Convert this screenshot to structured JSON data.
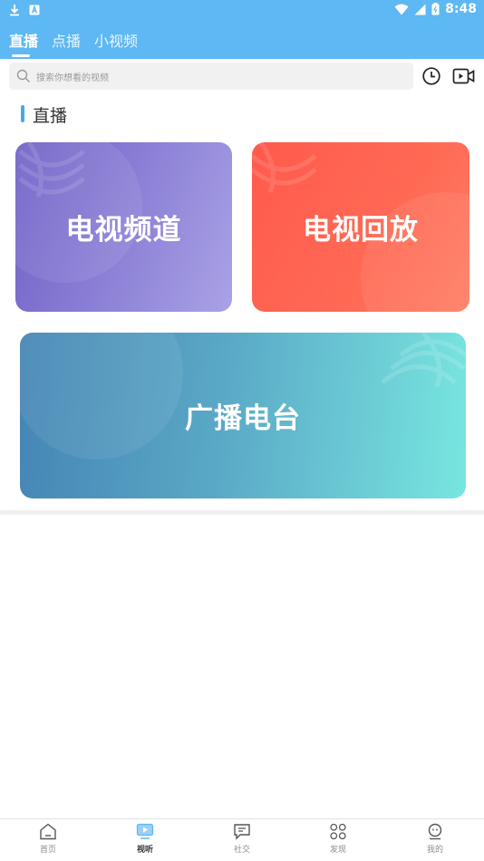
{
  "status_bar": {
    "time": "8:48"
  },
  "top_tabs": [
    {
      "label": "直播",
      "active": true
    },
    {
      "label": "点播",
      "active": false
    },
    {
      "label": "小视频",
      "active": false
    }
  ],
  "search": {
    "placeholder": "搜索你想看的视频"
  },
  "section": {
    "title": "直播"
  },
  "cards": {
    "tv_channels": "电视频道",
    "tv_replay": "电视回放",
    "radio": "广播电台"
  },
  "bottom_nav": [
    {
      "label": "首页",
      "icon": "home-icon",
      "active": false
    },
    {
      "label": "视听",
      "icon": "video-play-icon",
      "active": true
    },
    {
      "label": "社交",
      "icon": "chat-icon",
      "active": false
    },
    {
      "label": "发现",
      "icon": "discover-grid-icon",
      "active": false
    },
    {
      "label": "我的",
      "icon": "profile-icon",
      "active": false
    }
  ],
  "colors": {
    "brand_blue": "#5db8f3",
    "accent_bar": "#4aa8ea",
    "card_tv_start": "#6f60c6",
    "card_replay": "#ff5a4c",
    "card_radio_end": "#78e6e0"
  }
}
